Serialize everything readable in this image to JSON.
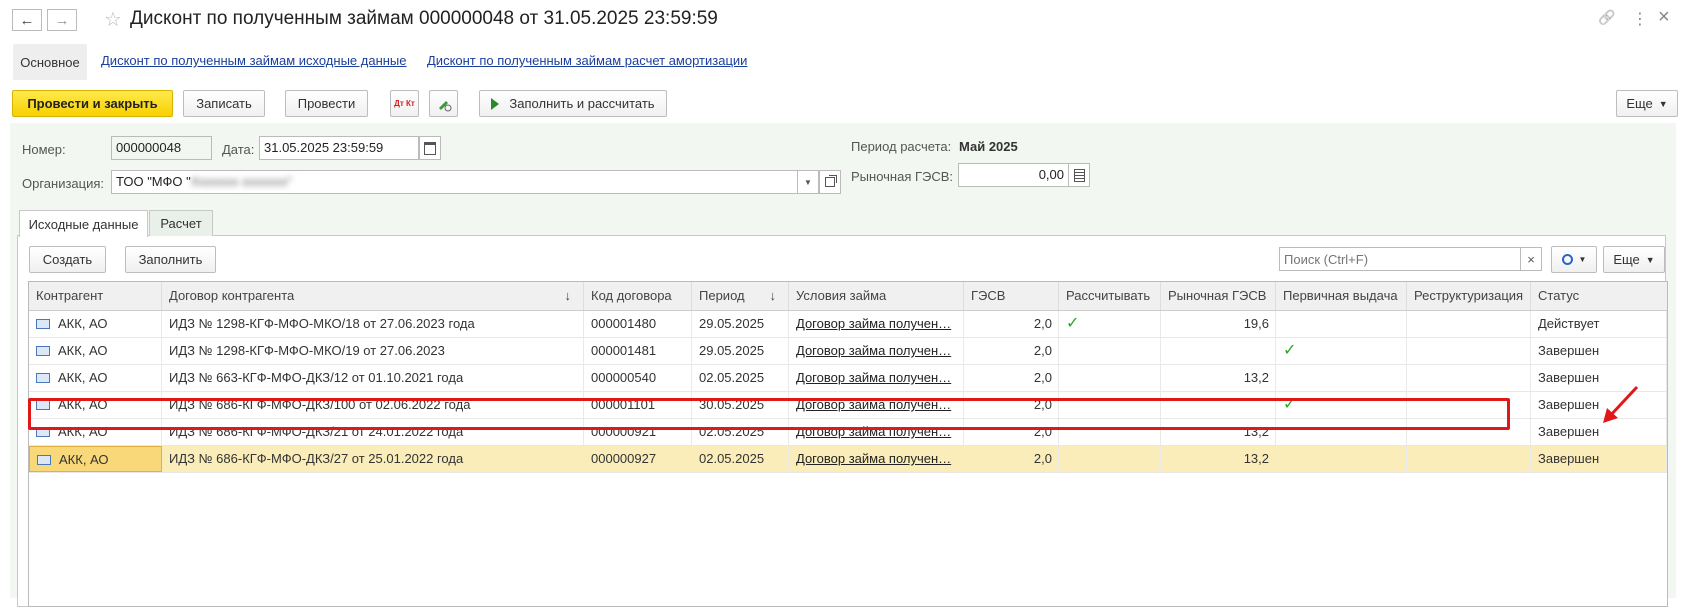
{
  "window": {
    "title": "Дисконт по полученным займам 000000048 от 31.05.2025 23:59:59",
    "back_glyph": "←",
    "forward_glyph": "→",
    "star_glyph": "☆",
    "link_glyph": "🔗",
    "more_glyph": "⋮",
    "close_glyph": "×"
  },
  "nav": {
    "main_tab": "Основное",
    "link1": "Дисконт по полученным займам исходные данные",
    "link2": "Дисконт по полученным займам расчет амортизации"
  },
  "toolbar": {
    "post_close": "Провести и закрыть",
    "save": "Записать",
    "post": "Провести",
    "dtkt_glyph": "Дт Кт",
    "fill_calc": "Заполнить и рассчитать",
    "more": "Еще"
  },
  "form": {
    "number_label": "Номер:",
    "number_value": "000000048",
    "date_label": "Дата:",
    "date_value": "31.05.2025 23:59:59",
    "org_label": "Организация:",
    "org_value": "ТОО \"МФО \"",
    "org_blurred": "Ххххххх ххххххх\"",
    "period_label": "Период расчета:",
    "period_value": "Май 2025",
    "rate_label": "Рыночная ГЭСВ:",
    "rate_value": "0,00"
  },
  "doc_tabs": {
    "tab1": "Исходные данные",
    "tab2": "Расчет"
  },
  "table_toolbar": {
    "create": "Создать",
    "fill": "Заполнить",
    "search_placeholder": "Поиск (Ctrl+F)",
    "more": "Еще"
  },
  "table": {
    "columns": [
      "Контрагент",
      "Договор контрагента",
      "Код договора",
      "Период",
      "Условия займа",
      "ГЭСВ",
      "Рассчитывать",
      "Рыночная ГЭСВ",
      "Первичная выдача",
      "Реструктуризация",
      "Статус"
    ],
    "sort_glyph": "↓",
    "rows": [
      {
        "counterparty": "АКК, АО",
        "contract": "ИДЗ № 1298-КГФ-МФО-МКО/18 от 27.06.2023 года",
        "code": "000001480",
        "period": "29.05.2025",
        "terms": "Договор займа получен…",
        "gesv": "2,0",
        "calc": "✓",
        "market": "19,6",
        "primary": "",
        "restruct": "",
        "status": "Действует"
      },
      {
        "counterparty": "АКК, АО",
        "contract": "ИДЗ № 1298-КГФ-МФО-МКО/19 от 27.06.2023",
        "code": "000001481",
        "period": "29.05.2025",
        "terms": "Договор займа получен…",
        "gesv": "2,0",
        "calc": "",
        "market": "",
        "primary": "✓",
        "restruct": "",
        "status": "Завершен"
      },
      {
        "counterparty": "АКК, АО",
        "contract": "ИДЗ № 663-КГФ-МФО-ДКЗ/12 от 01.10.2021 года",
        "code": "000000540",
        "period": "02.05.2025",
        "terms": "Договор займа получен…",
        "gesv": "2,0",
        "calc": "",
        "market": "13,2",
        "primary": "",
        "restruct": "",
        "status": "Завершен"
      },
      {
        "counterparty": "АКК, АО",
        "contract": "ИДЗ № 686-КГФ-МФО-ДКЗ/100 от 02.06.2022 года",
        "code": "000001101",
        "period": "30.05.2025",
        "terms": "Договор займа получен…",
        "gesv": "2,0",
        "calc": "",
        "market": "",
        "primary": "✓",
        "restruct": "",
        "status": "Завершен"
      },
      {
        "counterparty": "АКК, АО",
        "contract": "ИДЗ № 686-КГФ-МФО-ДКЗ/21 от 24.01.2022 года",
        "code": "000000921",
        "period": "02.05.2025",
        "terms": "Договор займа получен…",
        "gesv": "2,0",
        "calc": "",
        "market": "13,2",
        "primary": "",
        "restruct": "",
        "status": "Завершен"
      },
      {
        "counterparty": "АКК, АО",
        "contract": "ИДЗ № 686-КГФ-МФО-ДКЗ/27 от 25.01.2022 года",
        "code": "000000927",
        "period": "02.05.2025",
        "terms": "Договор займа получен…",
        "gesv": "2,0",
        "calc": "",
        "market": "13,2",
        "primary": "",
        "restruct": "",
        "status": "Завершен"
      }
    ]
  },
  "colors": {
    "accent_yellow": "#f8d100",
    "selected_row": "#fbedb9",
    "highlight_red": "#e01818",
    "check_green": "#2aa52a",
    "link_blue": "#1a3f9c"
  }
}
